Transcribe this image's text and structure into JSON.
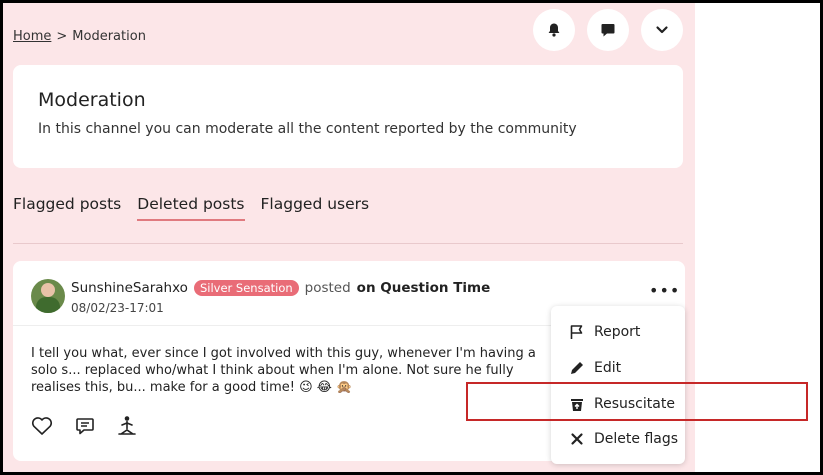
{
  "breadcrumb": {
    "home": "Home",
    "separator": ">",
    "current": "Moderation"
  },
  "topbar": {
    "icons": [
      "bell-icon",
      "chat-icon",
      "chevron-down-icon"
    ]
  },
  "moderation": {
    "title": "Moderation",
    "description": "In this channel you can moderate all the content reported by the community"
  },
  "tabs": [
    {
      "label": "Flagged posts",
      "active": false
    },
    {
      "label": "Deleted posts",
      "active": true
    },
    {
      "label": "Flagged users",
      "active": false
    }
  ],
  "post": {
    "username": "SunshineSarahxo",
    "badge": "Silver Sensation",
    "posted_label": "posted",
    "channel_prefix": "on",
    "channel": "Question Time",
    "date": "08/02/23-17:01",
    "more": "•••",
    "body": "I tell you what, ever since I got involved with this guy, whenever I'm having a solo s... replaced who/what I think about when I'm alone. Not sure he fully realises this, bu... make for a good time! 😉 😂 🙊",
    "actions": [
      "heart-icon",
      "comment-icon",
      "meditation-icon"
    ]
  },
  "menu": {
    "items": [
      {
        "label": "Report",
        "icon": "flag-icon"
      },
      {
        "label": "Edit",
        "icon": "pencil-icon"
      },
      {
        "label": "Resuscitate",
        "icon": "trash-restore-icon"
      },
      {
        "label": "Delete flags",
        "icon": "close-icon"
      }
    ]
  },
  "colors": {
    "page_bg": "#fce6e8",
    "accent": "#e96c77",
    "highlight": "#c62828"
  }
}
